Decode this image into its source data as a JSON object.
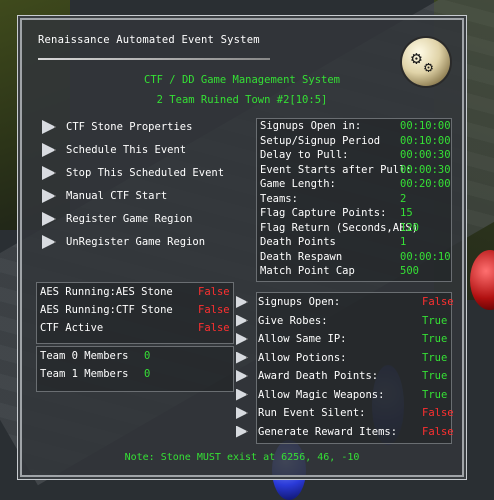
{
  "gump": {
    "title": "Renaissance Automated Event System",
    "system_title": "CTF / DD Game Management System",
    "subtitle": "2 Team Ruined Town #2[10:5]"
  },
  "actions": [
    {
      "label": "CTF Stone Properties"
    },
    {
      "label": "Schedule This Event"
    },
    {
      "label": "Stop This Scheduled Event"
    },
    {
      "label": "Manual CTF Start"
    },
    {
      "label": "Register Game Region"
    },
    {
      "label": "UnRegister Game Region"
    }
  ],
  "settings": [
    {
      "label": "Signups Open in:",
      "value": "00:10:00"
    },
    {
      "label": "Setup/Signup Period",
      "value": "00:10:00"
    },
    {
      "label": "Delay to Pull:",
      "value": "00:00:30"
    },
    {
      "label": "Event Starts after Pull:",
      "value": "00:00:30"
    },
    {
      "label": "Game Length:",
      "value": "00:20:00"
    },
    {
      "label": "Teams:",
      "value": "2"
    },
    {
      "label": "Flag Capture Points:",
      "value": "15"
    },
    {
      "label": "Flag Return (Seconds,AES)",
      "value": "120"
    },
    {
      "label": "Death Points",
      "value": "1"
    },
    {
      "label": "Death Respawn",
      "value": "00:00:10"
    },
    {
      "label": "Match Point Cap",
      "value": "500"
    }
  ],
  "status": [
    {
      "label": "AES Running:AES Stone",
      "value": "False"
    },
    {
      "label": "AES Running:CTF Stone",
      "value": "False"
    },
    {
      "label": "CTF Active",
      "value": "False"
    }
  ],
  "teams": [
    {
      "label": "Team 0 Members",
      "value": "0"
    },
    {
      "label": "Team 1 Members",
      "value": "0"
    }
  ],
  "toggles": [
    {
      "label": "Signups Open:",
      "value": "False",
      "color": "#ff3030"
    },
    {
      "label": "Give Robes:",
      "value": "True",
      "color": "#35e035"
    },
    {
      "label": "Allow Same IP:",
      "value": "True",
      "color": "#35e035"
    },
    {
      "label": "Allow Potions:",
      "value": "True",
      "color": "#35e035"
    },
    {
      "label": "Award Death Points:",
      "value": "True",
      "color": "#35e035"
    },
    {
      "label": "Allow Magic Weapons:",
      "value": "True",
      "color": "#35e035"
    },
    {
      "label": "Run Event Silent:",
      "value": "False",
      "color": "#ff3030"
    },
    {
      "label": "Generate Reward Items:",
      "value": "False",
      "color": "#ff3030"
    }
  ],
  "note": "Note: Stone MUST exist at 6256, 46, -10"
}
